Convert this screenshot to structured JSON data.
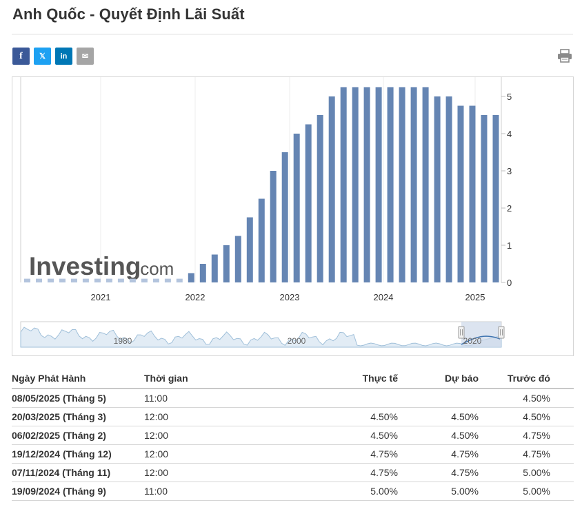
{
  "title": "Anh Quốc - Quyết Định Lãi Suất",
  "share": {
    "icons": [
      "facebook-icon",
      "twitter-icon",
      "linkedin-icon",
      "email-icon"
    ],
    "facebook_glyph": "f",
    "twitter_glyph": "𝕏",
    "linkedin_glyph": "in",
    "email_glyph": "✉",
    "print_icon": "printer-icon"
  },
  "colors": {
    "bar": "#6585b3",
    "bar_faded": "#b3c4dd",
    "navigator_line": "#9fbfd9",
    "navigator_fill": "#e2ecf5",
    "selection_fill": "#cdd9ea",
    "selection_line": "#3f74b0"
  },
  "watermark": {
    "brand": "Investing",
    "suffix": ".com"
  },
  "chart_data": {
    "type": "bar",
    "title": "",
    "xlabel": "",
    "ylabel": "",
    "ylim": [
      0,
      5.5
    ],
    "yticks": [
      0,
      1,
      2,
      3,
      4,
      5
    ],
    "xticks": [
      "2021",
      "2022",
      "2023",
      "2024",
      "2025"
    ],
    "grid": true,
    "legend": "none",
    "series": [
      {
        "values": [
          0.1,
          0.1,
          0.1,
          0.1,
          0.1,
          0.1,
          0.1,
          0.1,
          0.1,
          0.1,
          0.1,
          0.1,
          0.1,
          0.1,
          0.25,
          0.5,
          0.75,
          1.0,
          1.25,
          1.75,
          2.25,
          3.0,
          3.5,
          4.0,
          4.25,
          4.5,
          5.0,
          5.25,
          5.25,
          5.25,
          5.25,
          5.25,
          5.25,
          5.25,
          5.25,
          5.0,
          5.0,
          4.75,
          4.75,
          4.5,
          4.5
        ]
      }
    ],
    "navigator": {
      "xticks": [
        "1980",
        "2000",
        "2020"
      ]
    }
  },
  "table": {
    "headers": {
      "date": "Ngày Phát Hành",
      "time": "Thời gian",
      "actual": "Thực tế",
      "forecast": "Dự báo",
      "previous": "Trước đó"
    },
    "rows": [
      {
        "date": "08/05/2025 (Tháng 5)",
        "time": "11:00",
        "actual": "",
        "forecast": "",
        "previous": "4.50%"
      },
      {
        "date": "20/03/2025 (Tháng 3)",
        "time": "12:00",
        "actual": "4.50%",
        "forecast": "4.50%",
        "previous": "4.50%"
      },
      {
        "date": "06/02/2025 (Tháng 2)",
        "time": "12:00",
        "actual": "4.50%",
        "forecast": "4.50%",
        "previous": "4.75%"
      },
      {
        "date": "19/12/2024 (Tháng 12)",
        "time": "12:00",
        "actual": "4.75%",
        "forecast": "4.75%",
        "previous": "4.75%"
      },
      {
        "date": "07/11/2024 (Tháng 11)",
        "time": "12:00",
        "actual": "4.75%",
        "forecast": "4.75%",
        "previous": "5.00%"
      },
      {
        "date": "19/09/2024 (Tháng 9)",
        "time": "11:00",
        "actual": "5.00%",
        "forecast": "5.00%",
        "previous": "5.00%"
      }
    ]
  }
}
